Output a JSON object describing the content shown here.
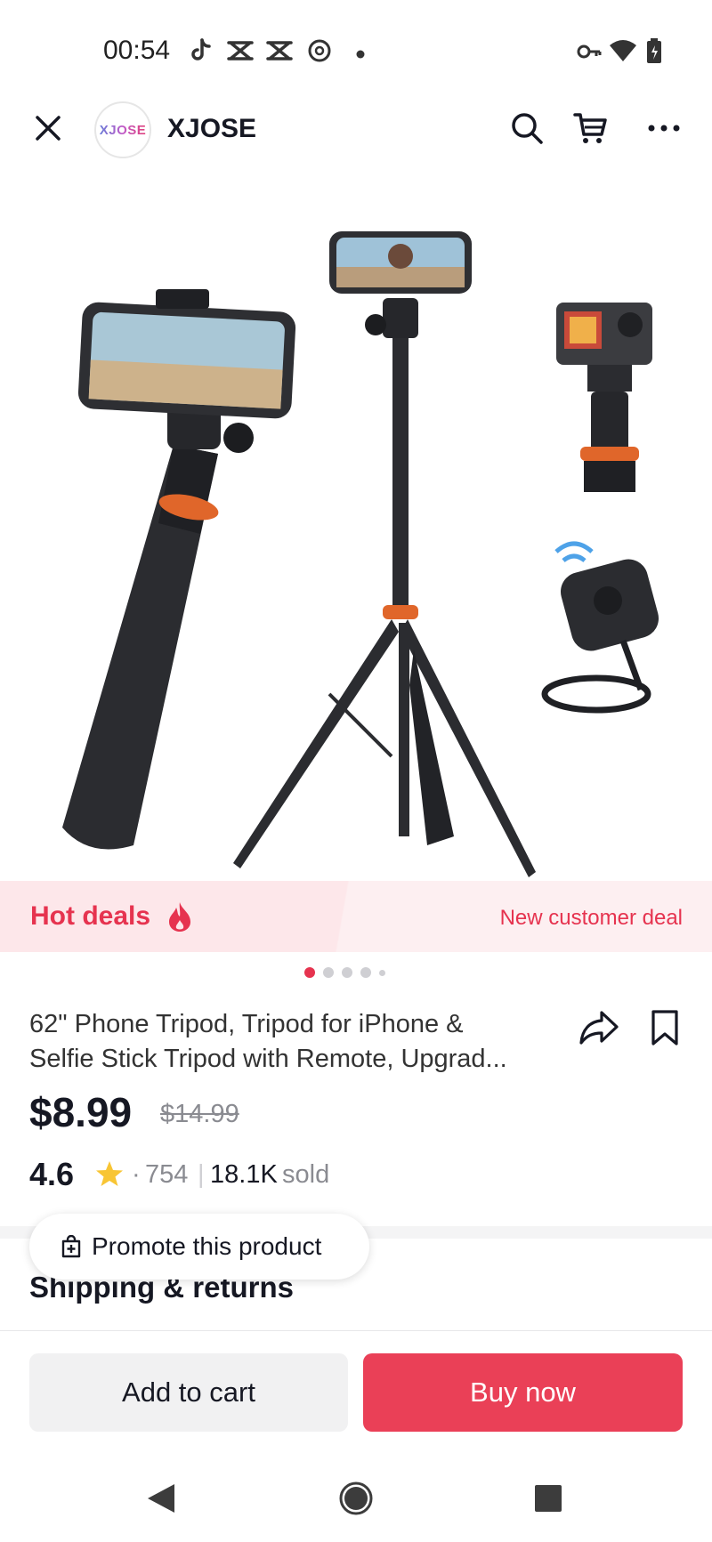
{
  "status_bar": {
    "time": "00:54",
    "left_icons": [
      "tiktok-icon",
      "capcut-icon",
      "capcut-icon",
      "threads-icon",
      "dot-icon"
    ],
    "right_icons": [
      "key-icon",
      "wifi-icon",
      "battery-icon"
    ]
  },
  "header": {
    "store_logo_text": "XJOSE",
    "store_name": "XJOSE",
    "icons": [
      "close-icon",
      "search-icon",
      "cart-icon",
      "more-icon"
    ]
  },
  "banner": {
    "hot_deals": "Hot deals",
    "new_customer_deal": "New customer deal"
  },
  "carousel": {
    "total": 5,
    "current": 1
  },
  "product": {
    "title_line1": "62\" Phone Tripod, Tripod for iPhone &",
    "title_line2": "Selfie Stick Tripod with Remote, Upgrad...",
    "price": "$8.99",
    "original_price": "$14.99",
    "rating": "4.6",
    "sep": "·",
    "reviews": "754",
    "pipe": "|",
    "sold_count": "18.1K",
    "sold_label": "sold"
  },
  "promote": {
    "label": "Promote this product"
  },
  "shipping": {
    "title": "Shipping & returns"
  },
  "actions": {
    "add_to_cart": "Add to cart",
    "buy_now": "Buy now"
  },
  "colors": {
    "accent": "#ea4057",
    "deal_text": "#e6334f",
    "star": "#f8c534"
  }
}
